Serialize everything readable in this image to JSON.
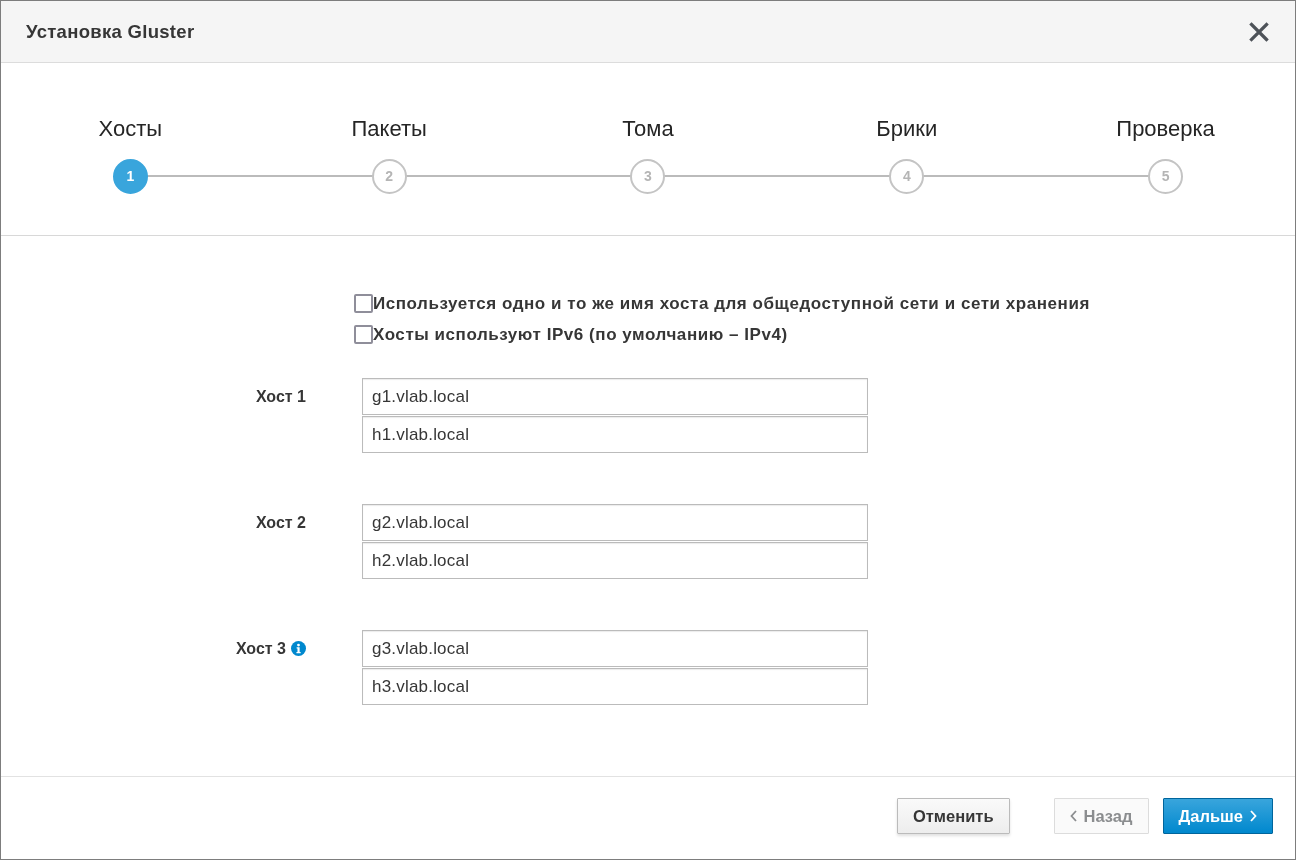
{
  "dialog": {
    "title": "Установка Gluster"
  },
  "steps": [
    {
      "number": "1",
      "label": "Хосты",
      "selected": true
    },
    {
      "number": "2",
      "label": "Пакеты",
      "selected": false
    },
    {
      "number": "3",
      "label": "Тома",
      "selected": false
    },
    {
      "number": "4",
      "label": "Брики",
      "selected": false
    },
    {
      "number": "5",
      "label": "Проверка",
      "selected": false
    }
  ],
  "options": [
    {
      "label": "Используется одно и то же имя хоста для общедоступной сети и сети хранения",
      "checked": false
    },
    {
      "label": "Хосты используют IPv6 (по умолчанию – IPv4)",
      "checked": false
    }
  ],
  "hosts": [
    {
      "label": "Хост 1",
      "info": false,
      "fields": [
        "g1.vlab.local",
        "h1.vlab.local"
      ]
    },
    {
      "label": "Хост 2",
      "info": false,
      "fields": [
        "g2.vlab.local",
        "h2.vlab.local"
      ]
    },
    {
      "label": "Хост 3",
      "info": true,
      "fields": [
        "g3.vlab.local",
        "h3.vlab.local"
      ]
    }
  ],
  "footer": {
    "buttons": [
      {
        "label": "Отменить",
        "kind": "cancel",
        "disabled": false
      },
      {
        "label": "Назад",
        "kind": "back",
        "disabled": true
      },
      {
        "label": "Дальше",
        "kind": "next",
        "disabled": false
      }
    ]
  }
}
